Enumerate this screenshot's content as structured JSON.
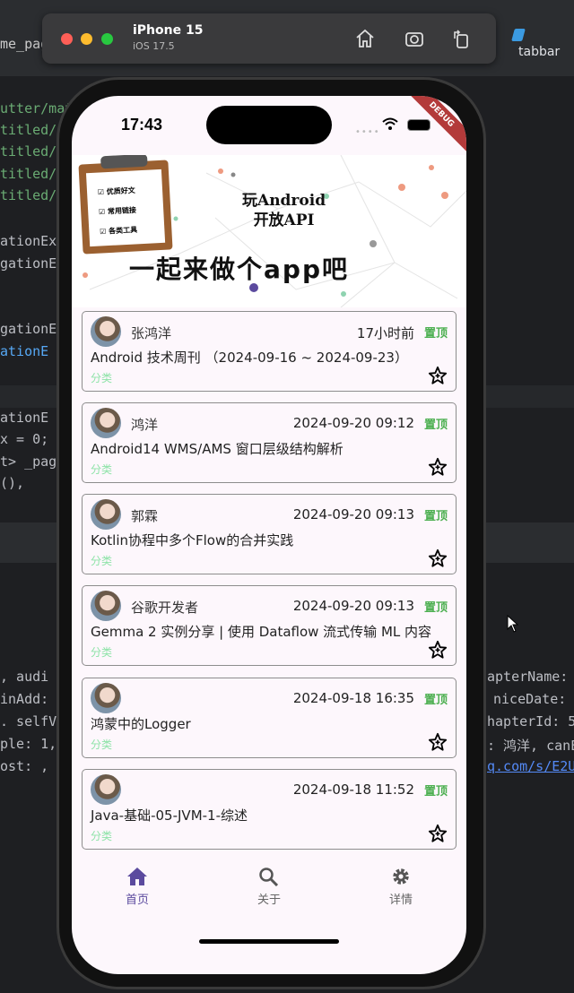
{
  "simulator": {
    "device": "iPhone 15",
    "os": "iOS 17.5",
    "editor_tab": "tabbar"
  },
  "ide_code": {
    "left": [
      "me_pag",
      "utter/mat",
      "titled/r",
      "titled/",
      "titled/",
      "titled/",
      "ationExa",
      "gationE",
      "gationE",
      "ationE",
      "ationE",
      "x = 0;",
      "t> _pag",
      "(),",
      ", audi",
      "inAdd:",
      ". selfVi",
      "ple: 1,",
      "ost: ,"
    ],
    "right": [
      "apterName:",
      "niceDate:",
      "hapterId: 5",
      ": 鸿洋, canE",
      "q.com/s/E2U"
    ]
  },
  "status_bar": {
    "time": "17:43",
    "debug_banner": "DEBUG"
  },
  "banner": {
    "title_line1": "玩Android",
    "title_line2": "开放API",
    "slogan": "一起来做个app吧",
    "clipboard_items": [
      "优质好文",
      "常用链接",
      "各类工具"
    ]
  },
  "articles": [
    {
      "author": "张鸿洋",
      "date": "17小时前",
      "tag": "置顶",
      "title": "Android 技术周刊 （2024-09-16 ~ 2024-09-23）",
      "category": "分类"
    },
    {
      "author": "鸿洋",
      "date": "2024-09-20 09:12",
      "tag": "置顶",
      "title": "Android14 WMS/AMS 窗口层级结构解析",
      "category": "分类"
    },
    {
      "author": "郭霖",
      "date": "2024-09-20 09:13",
      "tag": "置顶",
      "title": "Kotlin协程中多个Flow的合并实践",
      "category": "分类"
    },
    {
      "author": "谷歌开发者",
      "date": "2024-09-20 09:13",
      "tag": "置顶",
      "title": "Gemma 2 实例分享 | 使用 Dataflow 流式传输 ML 内容",
      "category": "分类"
    },
    {
      "author": "",
      "date": "2024-09-18 16:35",
      "tag": "置顶",
      "title": "鸿蒙中的Logger",
      "category": "分类"
    },
    {
      "author": "",
      "date": "2024-09-18 11:52",
      "tag": "置顶",
      "title": "Java-基础-05-JVM-1-综述",
      "category": "分类"
    }
  ],
  "bottom_nav": [
    {
      "label": "首页",
      "icon": "home-icon",
      "active": true
    },
    {
      "label": "关于",
      "icon": "search-icon"
    },
    {
      "label": "详情",
      "icon": "gear-icon"
    }
  ],
  "colors": {
    "accent": "#5b4a9e",
    "pin": "#4caf50",
    "category": "#8ee3a8",
    "screen_bg": "#fdf7fc"
  }
}
